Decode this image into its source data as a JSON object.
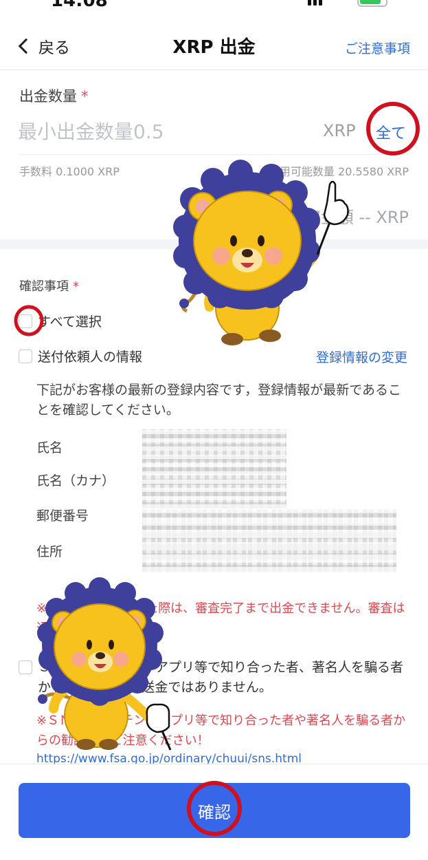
{
  "status_bar": {
    "time": "14:08"
  },
  "nav": {
    "back_label": "戻る",
    "title": "XRP 出金",
    "notice_link": "ご注意事項"
  },
  "withdraw": {
    "amount_label": "出金数量",
    "required_mark": "*",
    "amount_placeholder": "最小出金数量0.5",
    "unit": "XRP",
    "all_button": "全て",
    "fee": "手数料 0.1000 XRP",
    "available": "利用可能数量 20.5580 XRP",
    "received": "受取金額 -- XRP"
  },
  "confirm": {
    "label": "確認事項",
    "required_mark": "*",
    "select_all": "すべて選択",
    "sender_info": "送付依頼人の情報",
    "edit_link": "登録情報の変更",
    "description": "下記がお客様の最新の登録内容です，登録情報が最新であることを確認してください。",
    "fields": [
      "氏名",
      "氏名（カナ）",
      "郵便番号",
      "住所"
    ],
    "warning_change": "※登録情報を変更した際は、審査完了まで出金できません。審査は通常数日で完了します。",
    "sns_check": "ＳＮＳ・マッチングアプリ等で知り合った者、著名人を騙る者からの勧誘による送金ではありません。",
    "sns_warning": "※ＳＮＳ・マッチングアプリ等で知り合った者や著名人を騙る者からの勧誘等にご注意ください！",
    "url": "https://www.fsa.go.jp/ordinary/chuui/sns.html"
  },
  "footer": {
    "confirm_button": "確認"
  },
  "colors": {
    "accent": "#3866e8",
    "link": "#2f6cd8",
    "warning": "#e0474f",
    "highlight_circle": "#d0101e",
    "lion_body": "#f7c21e",
    "lion_mane": "#3f3f9c"
  },
  "annotations": {
    "icons": [
      "red-circle-highlight",
      "lion-mascot-icon",
      "pointing-hand-icon"
    ]
  }
}
